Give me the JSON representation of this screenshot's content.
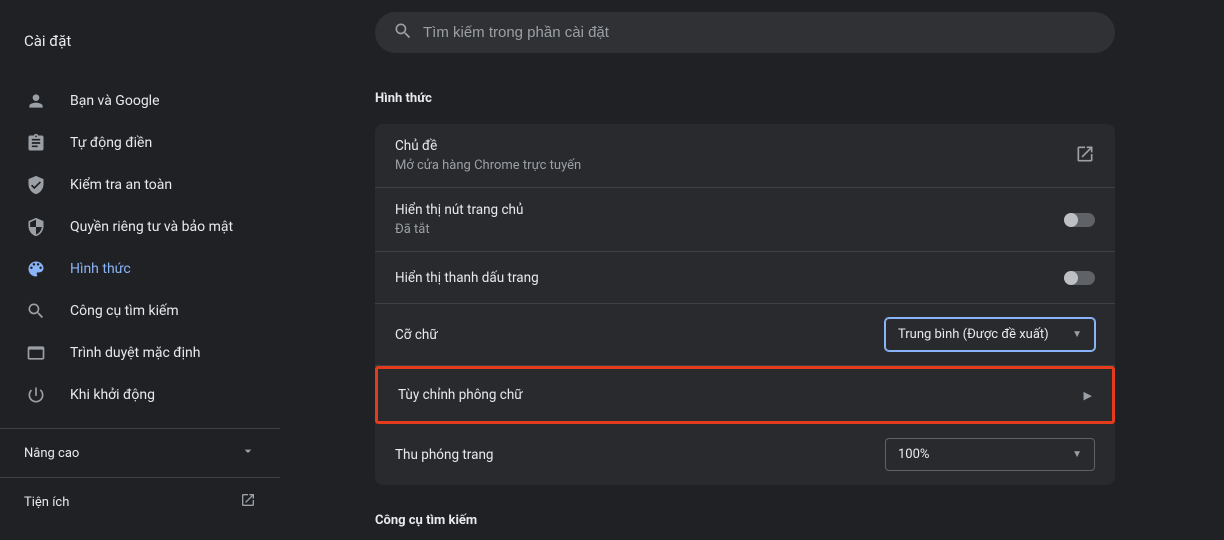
{
  "app_title": "Cài đặt",
  "search": {
    "placeholder": "Tìm kiếm trong phần cài đặt"
  },
  "sidebar": {
    "items": [
      {
        "label": "Bạn và Google"
      },
      {
        "label": "Tự động điền"
      },
      {
        "label": "Kiểm tra an toàn"
      },
      {
        "label": "Quyền riêng tư và bảo mật"
      },
      {
        "label": "Hình thức"
      },
      {
        "label": "Công cụ tìm kiếm"
      },
      {
        "label": "Trình duyệt mặc định"
      },
      {
        "label": "Khi khởi động"
      }
    ],
    "advanced": "Nâng cao",
    "extensions": "Tiện ích"
  },
  "appearance": {
    "section_title": "Hình thức",
    "theme": {
      "title": "Chủ đề",
      "subtitle": "Mở cửa hàng Chrome trực tuyến"
    },
    "home_button": {
      "title": "Hiển thị nút trang chủ",
      "subtitle": "Đã tắt"
    },
    "bookmarks_bar": {
      "title": "Hiển thị thanh dấu trang"
    },
    "font_size": {
      "title": "Cỡ chữ",
      "value": "Trung bình (Được đề xuất)"
    },
    "customize_fonts": {
      "title": "Tùy chỉnh phông chữ"
    },
    "page_zoom": {
      "title": "Thu phóng trang",
      "value": "100%"
    }
  },
  "search_engine": {
    "section_title": "Công cụ tìm kiếm"
  }
}
